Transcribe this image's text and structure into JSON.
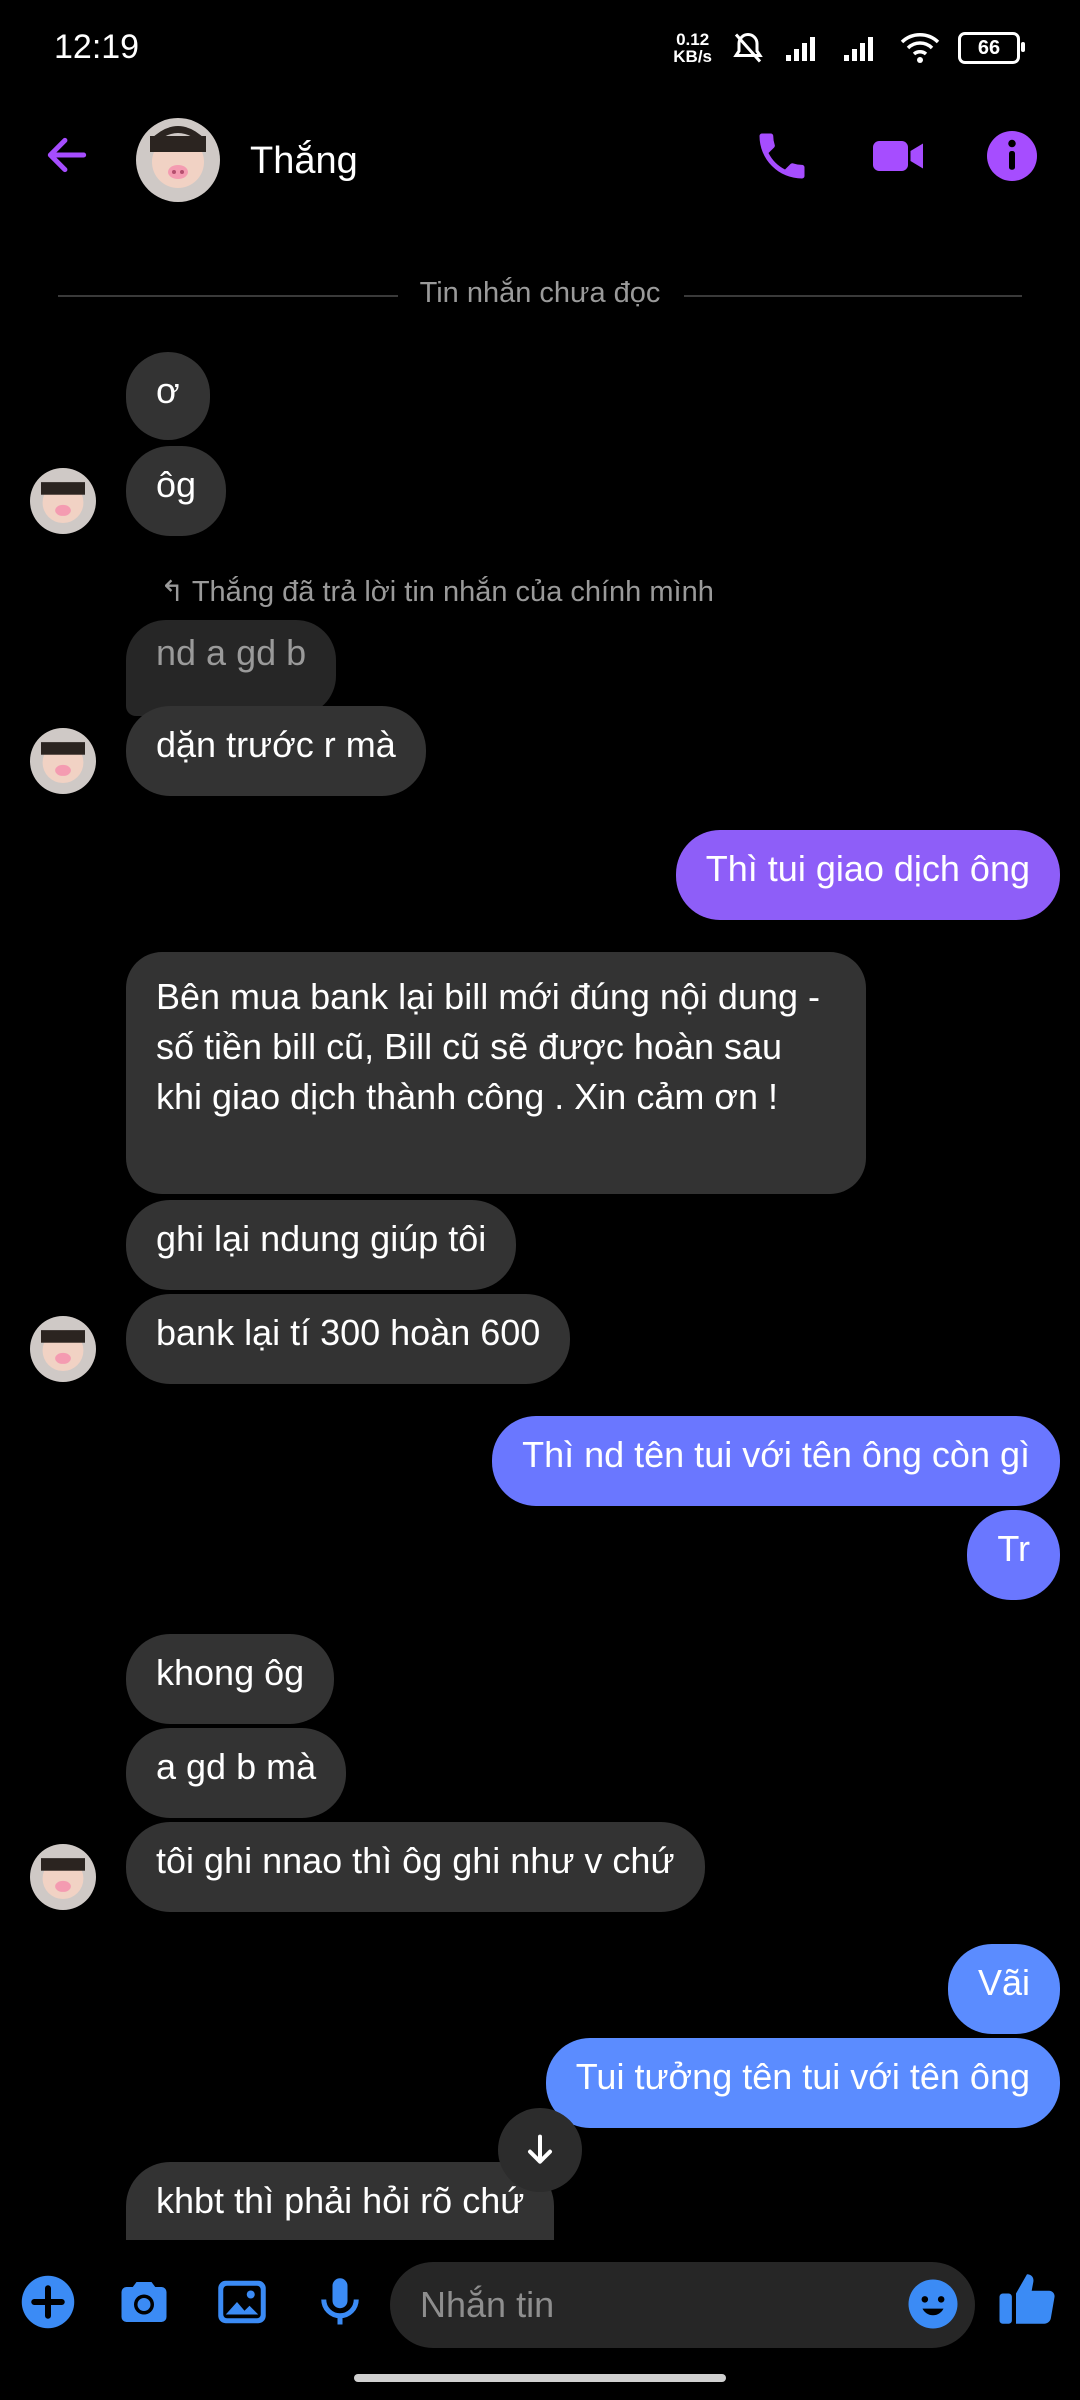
{
  "status_bar": {
    "time": "12:19",
    "net_speed_value": "0.12",
    "net_speed_unit": "KB/s",
    "battery": "66"
  },
  "header": {
    "contact_name": "Thắng",
    "icons": [
      "back-arrow-icon",
      "phone-icon",
      "video-icon",
      "info-icon"
    ],
    "accent_color": "#a64dff"
  },
  "divider": {
    "label": "Tin nhắn chưa đọc"
  },
  "messages": {
    "m1": "ơ",
    "m2": "ôg",
    "reply_note": "Thắng đã trả lời tin nhắn của chính mình",
    "reply_quote": "nd a gd b",
    "m3": "dặn trước r mà",
    "m4": "Thì tui giao dịch ông",
    "m5": "Bên mua bank lại bill mới đúng nội dung - số tiền bill cũ, Bill cũ sẽ được hoàn sau khi giao dịch thành công . Xin cảm ơn !",
    "m6": "ghi lại ndung giúp tôi",
    "m7": "bank lại tí 300 hoàn 600",
    "m8": "Thì nd tên tui với tên ông còn gì",
    "m9": "Tr",
    "m10": "khong ôg",
    "m11": "a gd b mà",
    "m12": "tôi ghi nnao thì ôg ghi như v chứ",
    "m13": "Vãi",
    "m14": "Tui tưởng tên tui với tên ông",
    "m15": "khbt thì phải hỏi rõ chứ"
  },
  "composer": {
    "placeholder": "Nhắn tin",
    "icons": [
      "plus-icon",
      "camera-icon",
      "gallery-icon",
      "mic-icon",
      "emoji-icon",
      "thumbs-up-icon"
    ],
    "accent_color": "#3b8bf5"
  }
}
